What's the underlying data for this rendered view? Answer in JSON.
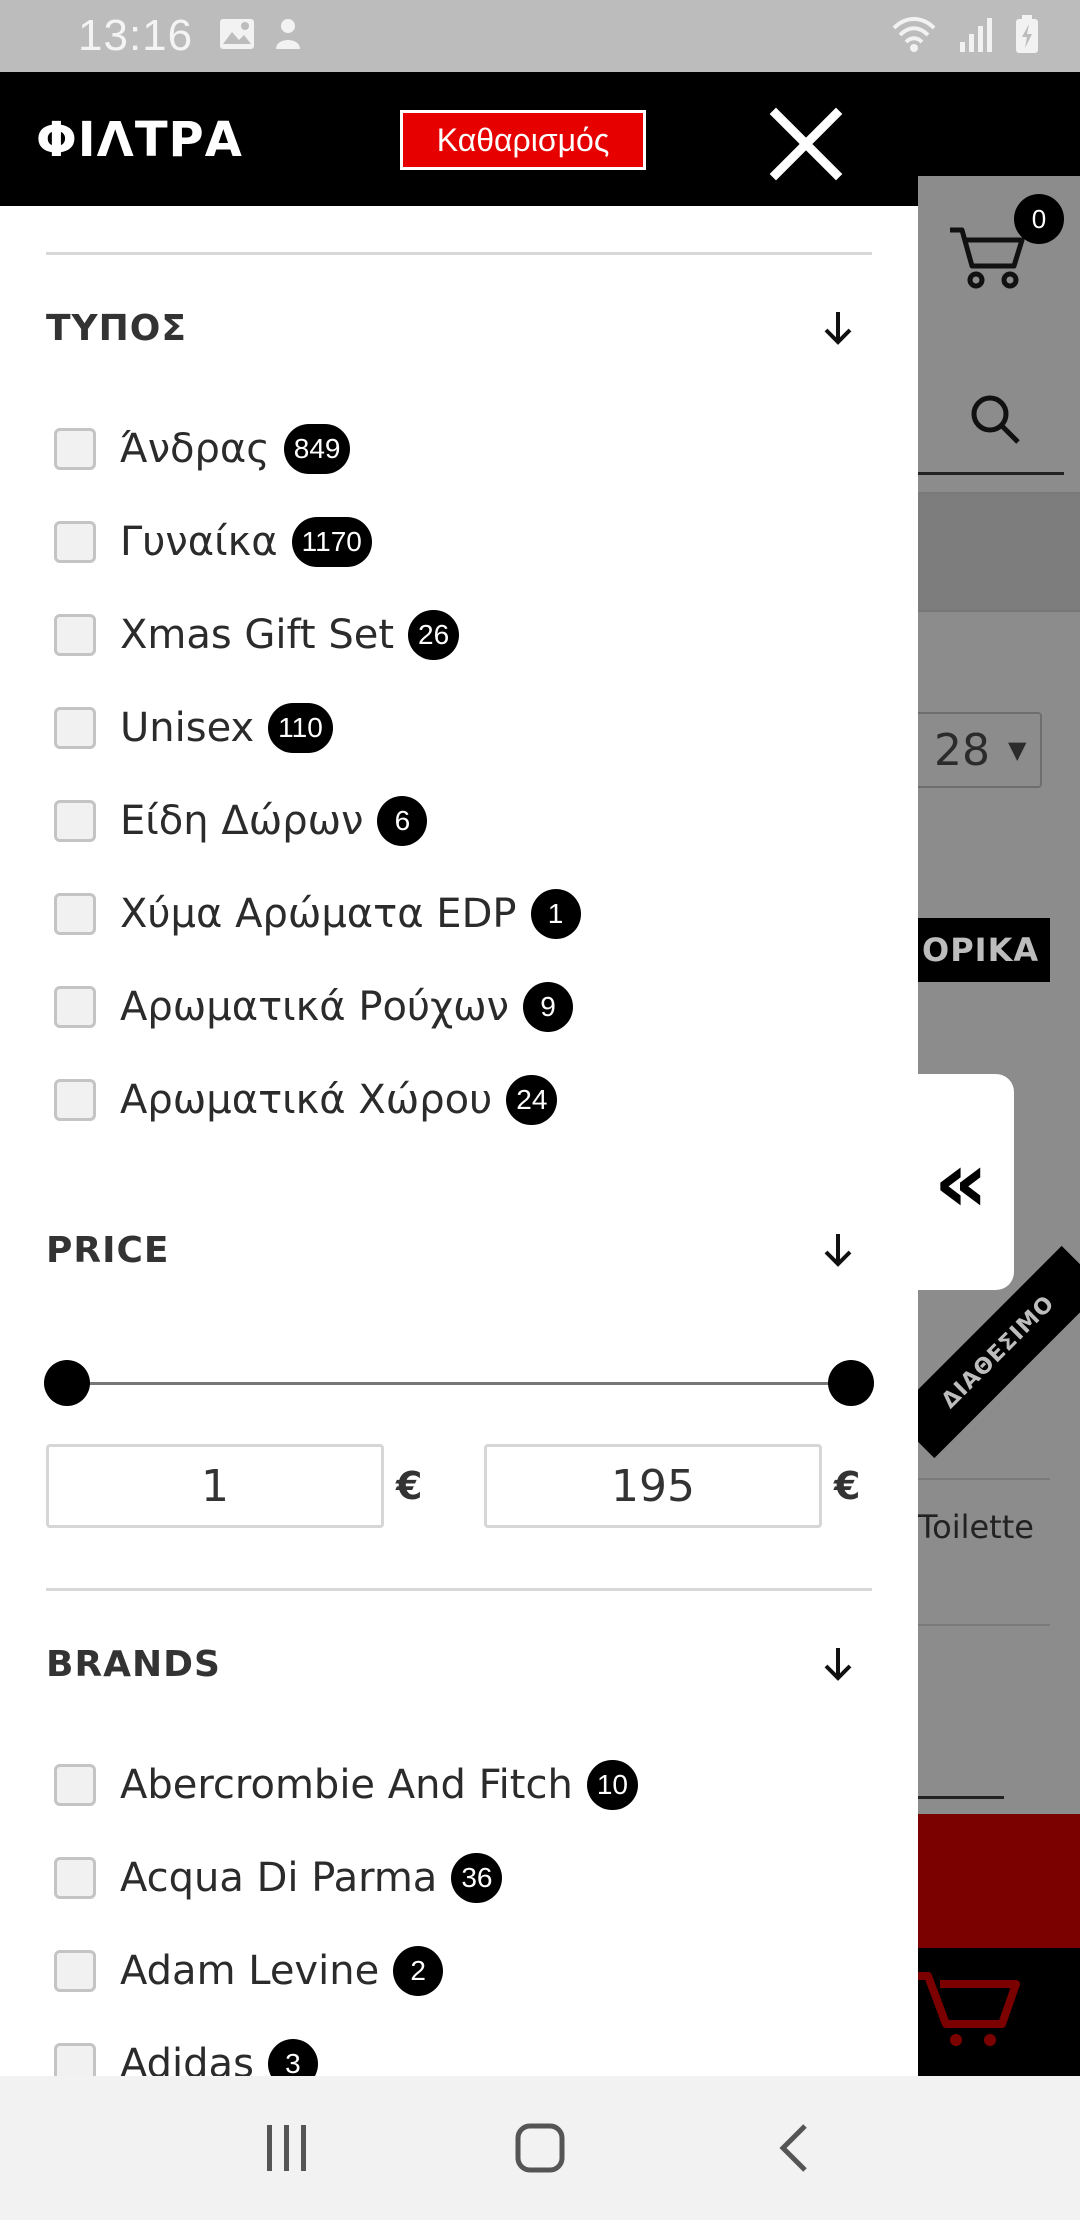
{
  "status_bar": {
    "time": "13:16"
  },
  "drawer": {
    "title": "ΦΙΛΤΡΑ",
    "clear_label": "Καθαρισμός"
  },
  "sections": {
    "type": {
      "title": "ΤΥΠΟΣ",
      "options": [
        {
          "label": "Άνδρας",
          "count": "849"
        },
        {
          "label": "Γυναίκα",
          "count": "1170"
        },
        {
          "label": "Xmas Gift Set",
          "count": "26"
        },
        {
          "label": "Unisex",
          "count": "110"
        },
        {
          "label": "Είδη Δώρων",
          "count": "6"
        },
        {
          "label": "Χύμα Αρώματα EDP",
          "count": "1"
        },
        {
          "label": "Αρωματικά Ρούχων",
          "count": "9"
        },
        {
          "label": "Αρωματικά Χώρου",
          "count": "24"
        }
      ]
    },
    "price": {
      "title": "PRICE",
      "min": "1",
      "max": "195",
      "currency": "€"
    },
    "brands": {
      "title": "BRANDS",
      "options": [
        {
          "label": "Abercrombie And Fitch",
          "count": "10"
        },
        {
          "label": "Acqua Di Parma",
          "count": "36"
        },
        {
          "label": "Adam Levine",
          "count": "2"
        },
        {
          "label": "Adidas",
          "count": "3"
        }
      ]
    }
  },
  "background_page": {
    "cart_count": "0",
    "select_value_partial": "28",
    "pill_text_partial": "ΟΡΙΚΑ",
    "ribbon_text": "ΔΙΑΘΕΣΙΜΟ",
    "product_text_partial": "Toilette"
  },
  "drawer_toggle": {
    "glyph": "«"
  }
}
